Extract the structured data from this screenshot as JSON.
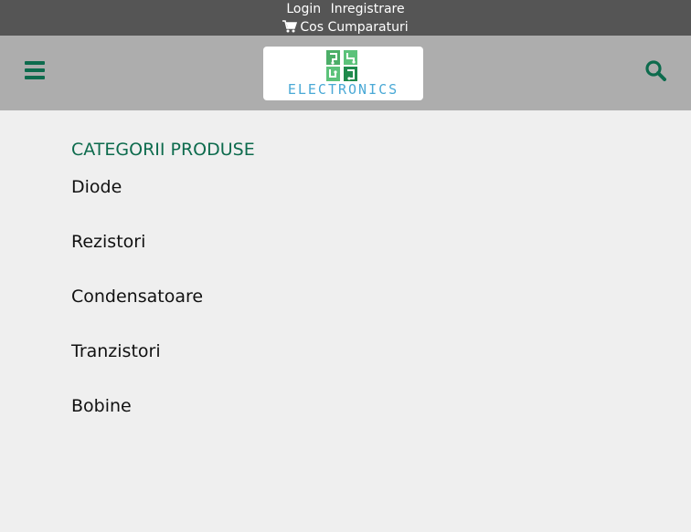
{
  "topbar": {
    "login_label": "Login",
    "register_label": "Inregistrare",
    "cart_label": "Cos Cumparaturi"
  },
  "header": {
    "logo_text": "ELECTRONICS",
    "menu_icon": "hamburger-menu-icon",
    "search_icon": "search-icon"
  },
  "categories": {
    "title": "CATEGORII PRODUSE",
    "items": [
      {
        "label": "Diode"
      },
      {
        "label": "Rezistori"
      },
      {
        "label": "Condensatoare"
      },
      {
        "label": "Tranzistori"
      },
      {
        "label": "Bobine"
      }
    ]
  },
  "colors": {
    "topbar_bg": "#555555",
    "header_bg": "#adadad",
    "page_bg": "#efefef",
    "accent_green": "#0d6b4d",
    "logo_blue": "#4aa9d6"
  }
}
